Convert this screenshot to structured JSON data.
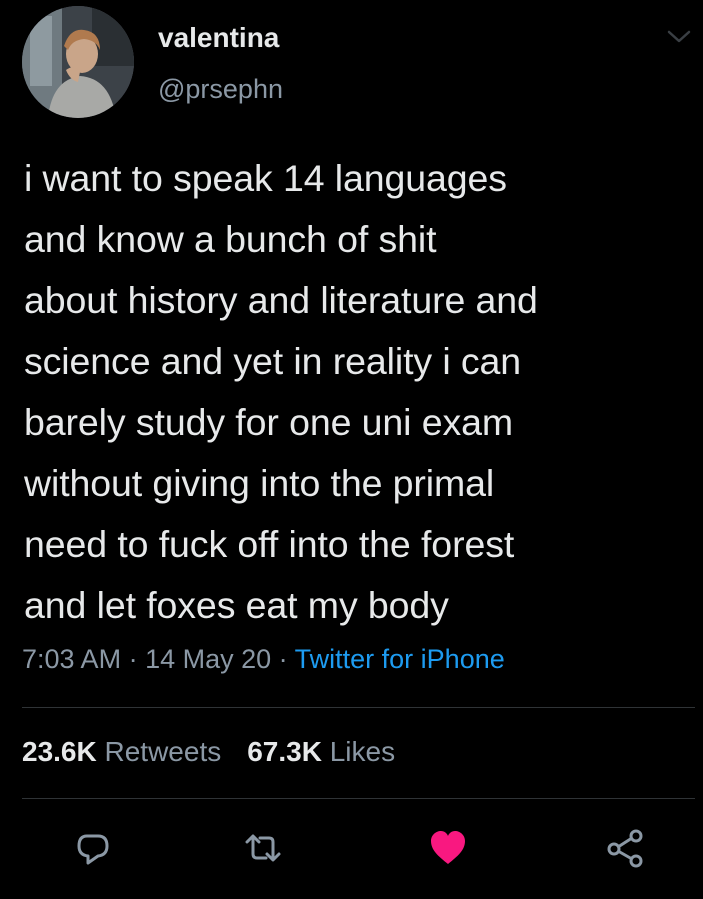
{
  "user": {
    "display_name": "valentina",
    "handle": "@prsephn",
    "avatar_icon": "profile-photo"
  },
  "tweet": {
    "text": "i want to speak 14 languages\nand know a bunch of shit\nabout history and literature and\nscience and yet in reality i can\nbarely study for one uni exam\nwithout giving into the primal\nneed to fuck off into the forest\nand let foxes eat my body",
    "time": "7:03 AM",
    "sep1": " · ",
    "date": "14 May 20",
    "sep2": " · ",
    "source": "Twitter for iPhone"
  },
  "stats": {
    "retweets_count": "23.6K",
    "retweets_label": "Retweets",
    "likes_count": "67.3K",
    "likes_label": "Likes"
  },
  "actions": [
    {
      "name": "reply",
      "icon": "reply-icon"
    },
    {
      "name": "retweet",
      "icon": "retweet-icon"
    },
    {
      "name": "like",
      "icon": "heart-icon",
      "active": true
    },
    {
      "name": "share",
      "icon": "share-icon"
    }
  ],
  "colors": {
    "background": "#000000",
    "text": "#e7e9ea",
    "secondary": "#8b98a5",
    "link": "#1d9bf0",
    "like": "#f91880",
    "divider": "#2f3336"
  }
}
